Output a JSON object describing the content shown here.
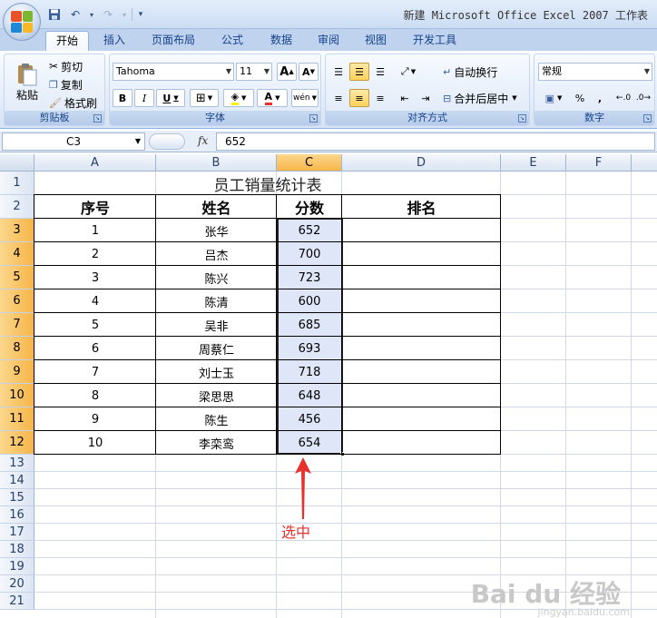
{
  "window": {
    "title": "新建 Microsoft Office Excel 2007 工作表"
  },
  "tabs": [
    "开始",
    "插入",
    "页面布局",
    "公式",
    "数据",
    "审阅",
    "视图",
    "开发工具"
  ],
  "active_tab": "开始",
  "ribbon": {
    "clipboard": {
      "label": "剪贴板",
      "paste": "粘贴",
      "cut": "剪切",
      "copy": "复制",
      "format_painter": "格式刷"
    },
    "font": {
      "label": "字体",
      "font_name": "Tahoma",
      "font_size": "11",
      "bold": "B",
      "italic": "I",
      "underline": "U",
      "grow": "A",
      "shrink": "A",
      "font_color": "A",
      "phonetic": "wén"
    },
    "alignment": {
      "label": "对齐方式",
      "wrap_text": "自动换行",
      "merge_center": "合并后居中"
    },
    "number": {
      "label": "数字",
      "format": "常规",
      "percent": "%",
      "comma": ","
    }
  },
  "formula_bar": {
    "name_box": "C3",
    "fx": "fx",
    "value": "652"
  },
  "columns": [
    "A",
    "B",
    "C",
    "D",
    "E",
    "F"
  ],
  "rows": [
    "1",
    "2",
    "3",
    "4",
    "5",
    "6",
    "7",
    "8",
    "9",
    "10",
    "11",
    "12",
    "13",
    "14",
    "15",
    "16",
    "17",
    "18",
    "19",
    "20",
    "21"
  ],
  "selected_column": "C",
  "table": {
    "title": "员工销量统计表",
    "headers": [
      "序号",
      "姓名",
      "分数",
      "排名"
    ],
    "rows": [
      [
        "1",
        "张华",
        "652",
        ""
      ],
      [
        "2",
        "吕杰",
        "700",
        ""
      ],
      [
        "3",
        "陈兴",
        "723",
        ""
      ],
      [
        "4",
        "陈清",
        "600",
        ""
      ],
      [
        "5",
        "吴非",
        "685",
        ""
      ],
      [
        "6",
        "周蔡仁",
        "693",
        ""
      ],
      [
        "7",
        "刘士玉",
        "718",
        ""
      ],
      [
        "8",
        "梁思思",
        "648",
        ""
      ],
      [
        "9",
        "陈生",
        "456",
        ""
      ],
      [
        "10",
        "李栾鸾",
        "654",
        ""
      ]
    ]
  },
  "annotation": {
    "text": "选中",
    "color": "#e8302d"
  },
  "watermark": {
    "text": "Bai du 经验",
    "sub": "jingyan.baidu.com"
  },
  "colors": {
    "accent": "#15428b",
    "selection_header": "#f7b548",
    "selection_fill": "#c4d1f0"
  }
}
